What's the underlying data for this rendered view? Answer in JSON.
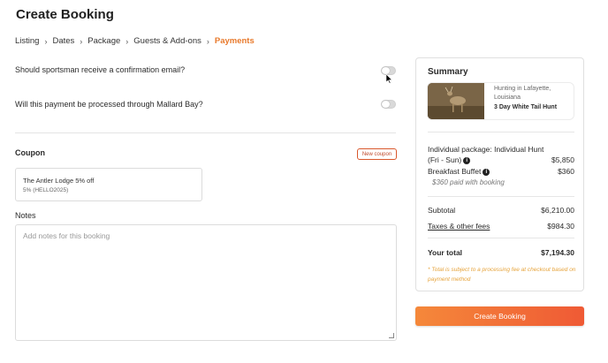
{
  "page": {
    "title": "Create Booking"
  },
  "breadcrumb": {
    "items": [
      "Listing",
      "Dates",
      "Package",
      "Guests & Add-ons"
    ],
    "active": "Payments"
  },
  "questions": {
    "confirmation_email": "Should sportsman receive a confirmation email?",
    "mallard_bay": "Will this payment be processed through Mallard Bay?"
  },
  "coupon": {
    "label": "Coupon",
    "new_button": "New coupon",
    "name": "The Antler Lodge 5% off",
    "code": "5% (HELLO2025)"
  },
  "notes": {
    "label": "Notes",
    "placeholder": "Add notes for this booking"
  },
  "summary": {
    "title": "Summary",
    "listing_location": "Hunting in Lafayette, Louisiana",
    "listing_name": "3 Day White Tail Hunt",
    "package_line1": "Individual package: Individual Hunt",
    "package_line2": "(Fri - Sun)",
    "package_price": "$5,850",
    "addon_name": "Breakfast Buffet",
    "addon_price": "$360",
    "addon_note": "$360 paid with booking",
    "subtotal_label": "Subtotal",
    "subtotal_value": "$6,210.00",
    "taxes_label": "Taxes & other fees",
    "taxes_value": "$984.30",
    "total_label": "Your total",
    "total_value": "$7,194.30",
    "footnote": "* Total is subject to a processing fee at checkout based on payment method"
  },
  "actions": {
    "create_booking": "Create Booking"
  },
  "colors": {
    "accent": "#e8792b",
    "button_start": "#f5883a",
    "button_end": "#ef5a35",
    "footnote": "#e6a33b"
  }
}
